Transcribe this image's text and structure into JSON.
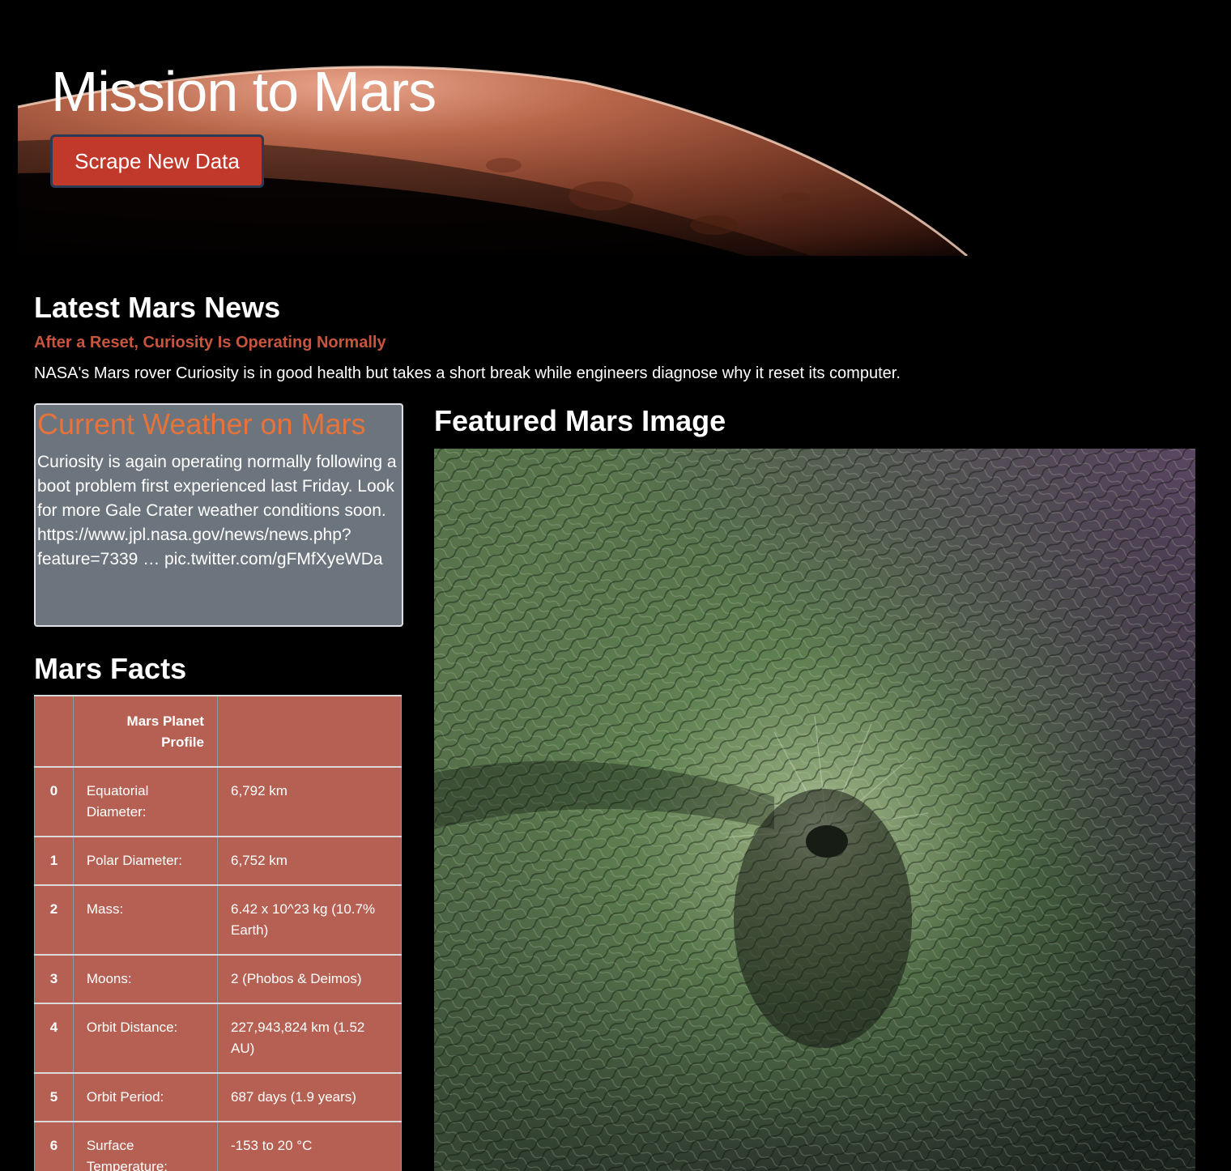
{
  "header": {
    "title": "Mission to Mars",
    "scrape_button_label": "Scrape New Data"
  },
  "news": {
    "heading": "Latest Mars News",
    "title": "After a Reset, Curiosity Is Operating Normally",
    "teaser": "NASA's Mars rover Curiosity is in good health but takes a short break while engineers diagnose why it reset its computer."
  },
  "weather": {
    "heading": "Current Weather on Mars",
    "text": "Curiosity is again operating normally following a boot problem first experienced last Friday. Look for more Gale Crater weather conditions soon. https://www.jpl.nasa.gov/news/news.php?feature=7339 … pic.twitter.com/gFMfXyeWDa"
  },
  "facts": {
    "heading": "Mars Facts",
    "header_cells": [
      "",
      "Mars Planet Profile",
      ""
    ],
    "rows": [
      {
        "index": "0",
        "label": "Equatorial Diameter:",
        "value": "6,792 km"
      },
      {
        "index": "1",
        "label": "Polar Diameter:",
        "value": "6,752 km"
      },
      {
        "index": "2",
        "label": "Mass:",
        "value": "6.42 x 10^23 kg (10.7% Earth)"
      },
      {
        "index": "3",
        "label": "Moons:",
        "value": "2 (Phobos & Deimos)"
      },
      {
        "index": "4",
        "label": "Orbit Distance:",
        "value": "227,943,824 km (1.52 AU)"
      },
      {
        "index": "5",
        "label": "Orbit Period:",
        "value": "687 days (1.9 years)"
      },
      {
        "index": "6",
        "label": "Surface Temperature:",
        "value": "-153 to 20 °C"
      }
    ]
  },
  "featured": {
    "heading": "Featured Mars Image"
  },
  "colors": {
    "accent": "#c8553d",
    "weather_heading": "#e8733a",
    "button": "#c0392b",
    "table_bg": "#b56052",
    "card_bg": "#6c757d"
  }
}
